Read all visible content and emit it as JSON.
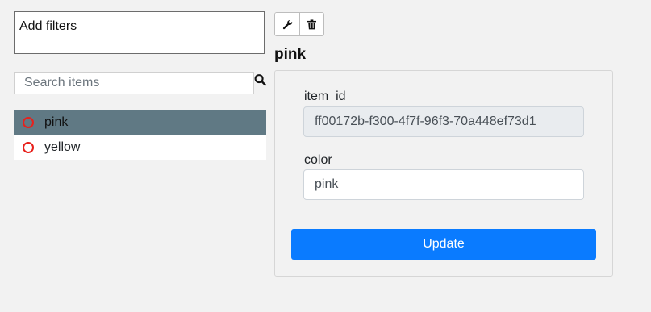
{
  "filters": {
    "label": "Add filters"
  },
  "search": {
    "placeholder": "Search items",
    "value": ""
  },
  "items": [
    {
      "label": "pink",
      "selected": true
    },
    {
      "label": "yellow",
      "selected": false
    }
  ],
  "toolbar": {
    "edit_icon": "wrench-icon",
    "delete_icon": "trash-icon"
  },
  "detail": {
    "title": "pink",
    "fields": {
      "item_id": {
        "label": "item_id",
        "value": "ff00172b-f300-4f7f-96f3-70a448ef73d1"
      },
      "color": {
        "label": "color",
        "value": "pink"
      }
    },
    "update_label": "Update"
  },
  "colors": {
    "accent": "#0a7bff",
    "selected_row": "#607984",
    "ring": "#e8201b"
  }
}
